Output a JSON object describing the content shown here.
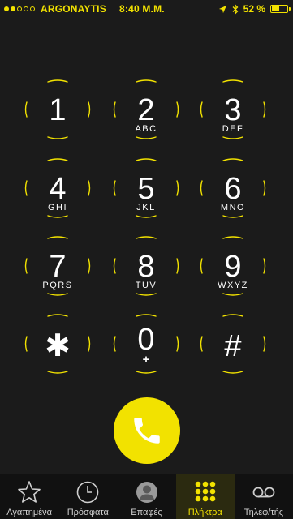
{
  "colors": {
    "accent": "#f2e200",
    "background": "#1b1b1b",
    "tabbar_background": "#111111"
  },
  "status_bar": {
    "signal_filled": 2,
    "signal_total": 5,
    "carrier": "ARGONAYTIS",
    "time": "8:40 M.M.",
    "icons": [
      "location-arrow-icon",
      "bluetooth-icon",
      "battery-icon"
    ],
    "battery_text": "52 %",
    "battery_level": 0.52
  },
  "keypad": {
    "keys": [
      {
        "digit": "1",
        "letters": ""
      },
      {
        "digit": "2",
        "letters": "ABC"
      },
      {
        "digit": "3",
        "letters": "DEF"
      },
      {
        "digit": "4",
        "letters": "GHI"
      },
      {
        "digit": "5",
        "letters": "JKL"
      },
      {
        "digit": "6",
        "letters": "MNO"
      },
      {
        "digit": "7",
        "letters": "PQRS"
      },
      {
        "digit": "8",
        "letters": "TUV"
      },
      {
        "digit": "9",
        "letters": "WXYZ"
      },
      {
        "digit": "✱",
        "letters": ""
      },
      {
        "digit": "0",
        "letters": "+"
      },
      {
        "digit": "#",
        "letters": ""
      }
    ]
  },
  "call_button": {
    "icon": "phone-icon"
  },
  "tab_bar": {
    "tabs": [
      {
        "label": "Αγαπημένα",
        "icon": "star-icon",
        "active": false
      },
      {
        "label": "Πρόσφατα",
        "icon": "clock-icon",
        "active": false
      },
      {
        "label": "Επαφές",
        "icon": "contacts-icon",
        "active": false
      },
      {
        "label": "Πλήκτρα",
        "icon": "keypad-icon",
        "active": true
      },
      {
        "label": "Τηλεφ/τής",
        "icon": "voicemail-icon",
        "active": false
      }
    ]
  }
}
